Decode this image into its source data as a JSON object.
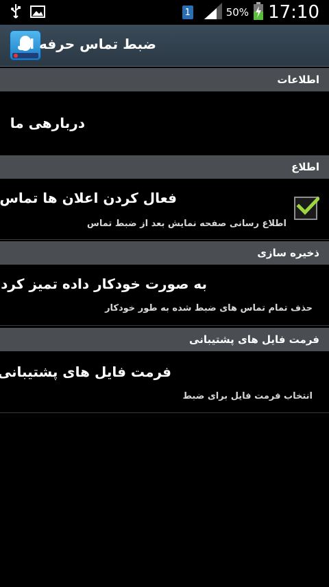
{
  "statusbar": {
    "battery_percent": "50%",
    "time": "17:10",
    "sim_slot": "1",
    "icons": [
      "usb-icon",
      "image-icon",
      "sim-icon",
      "signal-icon",
      "battery-charging-icon"
    ]
  },
  "actionbar": {
    "title": "ضبط تماس حرفه ای"
  },
  "sections": [
    {
      "header": "اطلاعات",
      "items": [
        {
          "title": "دربارهی ما"
        }
      ]
    },
    {
      "header": "اطلاع",
      "items": [
        {
          "title": "فعال کردن اعلان ها تماس",
          "subtitle": "اطلاع رسانی صفحه نمایش بعد از ضبط تماس",
          "checked": true
        }
      ]
    },
    {
      "header": "ذخیره سازی",
      "items": [
        {
          "title": "به صورت خودکار داده تمیز کردن",
          "subtitle": "حذف تمام تماس های ضبط شده به طور خودکار"
        }
      ]
    },
    {
      "header": "فرمت فایل های پشتیبانی",
      "items": [
        {
          "title": "فرمت فایل های پشتیبانی",
          "subtitle": "انتخاب فرمت فایل برای ضبط"
        }
      ]
    }
  ],
  "colors": {
    "check_mark": "#9fd640",
    "section_header_bg": "#4a4d52",
    "actionbar_bg": "#34434f"
  }
}
